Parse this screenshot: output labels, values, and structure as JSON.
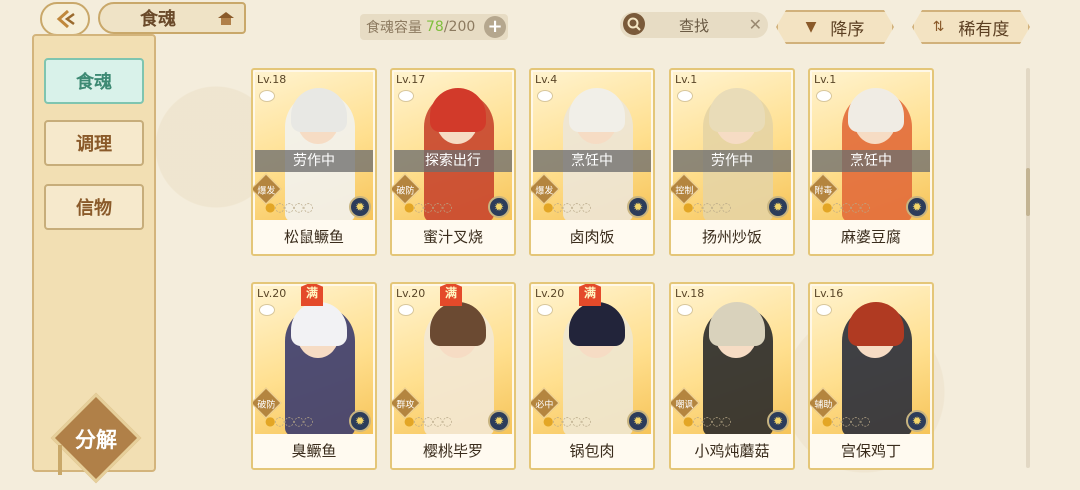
{
  "header": {
    "title": "食魂",
    "capacity_label": "食魂容量",
    "capacity_current": "78",
    "capacity_total": "/200",
    "plus": "+",
    "search_placeholder": "查找",
    "search_clear": "✕",
    "sort_desc": "降序",
    "sort_rarity": "稀有度"
  },
  "sidebar": {
    "tabs": [
      {
        "label": "食魂",
        "active": true
      },
      {
        "label": "调理",
        "active": false
      },
      {
        "label": "信物",
        "active": false
      }
    ],
    "decompose": "分解"
  },
  "cards": [
    {
      "level": "Lv.18",
      "status": "劳作中",
      "role": "爆发",
      "name": "松鼠鳜鱼",
      "full": "",
      "stars_filled": 1,
      "hair": "#e8e8e4",
      "outfit": "#f2f2ee"
    },
    {
      "level": "Lv.17",
      "status": "探索出行",
      "role": "破防",
      "name": "蜜汁叉烧",
      "full": "",
      "stars_filled": 1,
      "hair": "#d23a2a",
      "outfit": "#c8452c"
    },
    {
      "level": "Lv.4",
      "status": "烹饪中",
      "role": "爆发",
      "name": "卤肉饭",
      "full": "",
      "stars_filled": 1,
      "hair": "#f1efe8",
      "outfit": "#ede6d6"
    },
    {
      "level": "Lv.1",
      "status": "劳作中",
      "role": "控制",
      "name": "扬州炒饭",
      "full": "",
      "stars_filled": 1,
      "hair": "#e9dcb8",
      "outfit": "#e6d4a4"
    },
    {
      "level": "Lv.1",
      "status": "烹饪中",
      "role": "附毒",
      "name": "麻婆豆腐",
      "full": "",
      "stars_filled": 1,
      "hair": "#f0ece4",
      "outfit": "#e26c3a"
    },
    {
      "level": "Lv.20",
      "status": "",
      "role": "破防",
      "name": "臭鳜鱼",
      "full": "满",
      "stars_filled": 1,
      "hair": "#f2f2f4",
      "outfit": "#3c3c6e"
    },
    {
      "level": "Lv.20",
      "status": "",
      "role": "群攻",
      "name": "樱桃毕罗",
      "full": "满",
      "stars_filled": 1,
      "hair": "#6b4a32",
      "outfit": "#f3e8d4"
    },
    {
      "level": "Lv.20",
      "status": "",
      "role": "必中",
      "name": "锅包肉",
      "full": "满",
      "stars_filled": 1,
      "hair": "#22243a",
      "outfit": "#eee7d0"
    },
    {
      "level": "Lv.18",
      "status": "",
      "role": "嘲讽",
      "name": "小鸡炖蘑菇",
      "full": "",
      "stars_filled": 1,
      "hair": "#d9d2bc",
      "outfit": "#2a2a2a"
    },
    {
      "level": "Lv.16",
      "status": "",
      "role": "辅助",
      "name": "宫保鸡丁",
      "full": "",
      "stars_filled": 1,
      "hair": "#b03a22",
      "outfit": "#2a2e3a"
    }
  ],
  "colors": {
    "accent": "#c9a86a",
    "active_tab": "#d9f2ea",
    "capacity_current": "#7fbf3d"
  }
}
